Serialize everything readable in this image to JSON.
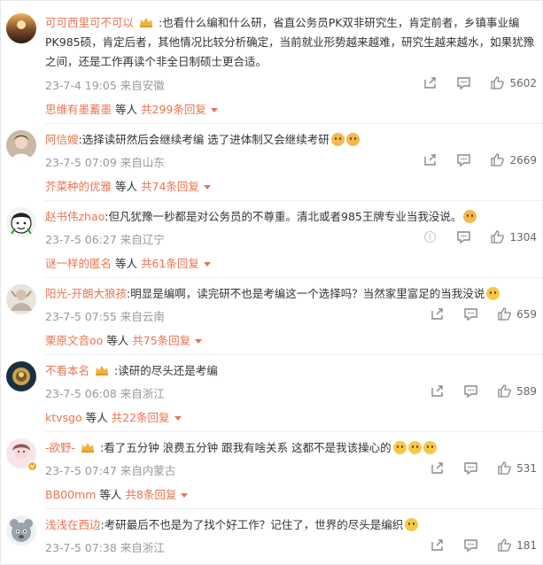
{
  "colors": {
    "accent": "#eb7350",
    "meta": "#999999",
    "text": "#333333"
  },
  "comments": [
    {
      "user": "可可西里可不可以",
      "text": ":也看什么编和什么研，省直公务员PK双非研究生，肯定前者，乡镇事业编PK985硕，肯定后者，其他情况比较分析确定，当前就业形势越来越难，研究生越来越水，如果犹豫之间，还是工作再读个非全日制硕士更合适。",
      "time": "23-7-4 19:05 来自安徽",
      "likes": "5602",
      "reply_name": "思维有墨蓄墨",
      "reply_mid": "等人",
      "reply_count": "共299条回复"
    },
    {
      "user": "阿信嫂",
      "text": ":选择读研然后会继续考编 选了进体制又会继续考研",
      "time": "23-7-5 07:09 来自山东",
      "likes": "2669",
      "reply_name": "芥菜种的优雅",
      "reply_mid": "等人",
      "reply_count": "共74条回复"
    },
    {
      "user": "赵书伟zhao",
      "text": ":但凡犹豫一秒都是对公务员的不尊重。清北或者985王牌专业当我没说。",
      "time": "23-7-5 06:27 来自辽宁",
      "likes": "1304",
      "reply_name": "谜一样的匿名",
      "reply_mid": "等人",
      "reply_count": "共61条回复"
    },
    {
      "user": "阳光-开朗大狼孩",
      "text": ":明显是编啊，读完研不也是考编这一个选择吗？当然家里富足的当我没说",
      "time": "23-7-5 07:55 来自云南",
      "likes": "659",
      "reply_name": "栗原文音oo",
      "reply_mid": "等人",
      "reply_count": "共75条回复"
    },
    {
      "user": "不看本名",
      "text": ":读研的尽头还是考编",
      "time": "23-7-5 06:08 来自浙江",
      "likes": "589",
      "reply_name": "ktvsgo",
      "reply_mid": "等人",
      "reply_count": "共22条回复"
    },
    {
      "user": "-欲野-",
      "text": ":看了五分钟 浪费五分钟 跟我有啥关系 这都不是我该操心的",
      "time": "23-7-5 07:47 来自内蒙古",
      "likes": "531",
      "reply_name": "BB00mm",
      "reply_mid": "等人",
      "reply_count": "共8条回复"
    },
    {
      "user": "浅浅在西边",
      "text": ":考研最后不也是为了找个好工作？记住了，世界的尽头是编织",
      "time": "23-7-5 07:38 来自浙江",
      "likes": "181",
      "reply_name": "",
      "reply_mid": "",
      "reply_count": ""
    }
  ]
}
